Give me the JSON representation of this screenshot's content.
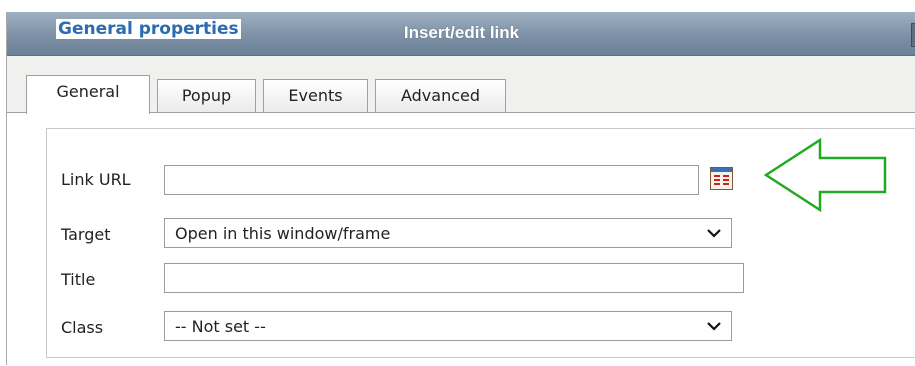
{
  "dialog": {
    "title": "Insert/edit link"
  },
  "tabs": [
    {
      "label": "General",
      "active": true
    },
    {
      "label": "Popup",
      "active": false
    },
    {
      "label": "Events",
      "active": false
    },
    {
      "label": "Advanced",
      "active": false
    }
  ],
  "general": {
    "legend": "General properties",
    "link_url": {
      "label": "Link URL",
      "value": ""
    },
    "target": {
      "label": "Target",
      "value": "Open in this window/frame"
    },
    "title": {
      "label": "Title",
      "value": ""
    },
    "class": {
      "label": "Class",
      "value": "-- Not set --"
    }
  },
  "icons": {
    "browse": "file-browser-icon",
    "chevron": "chevron-down-icon",
    "annotation": "arrow-left-icon"
  },
  "colors": {
    "title_bar": "#7d90a5",
    "legend_text": "#2b6cb0",
    "annotation_arrow": "#22aa22",
    "browse_icon": "#cc2222"
  }
}
